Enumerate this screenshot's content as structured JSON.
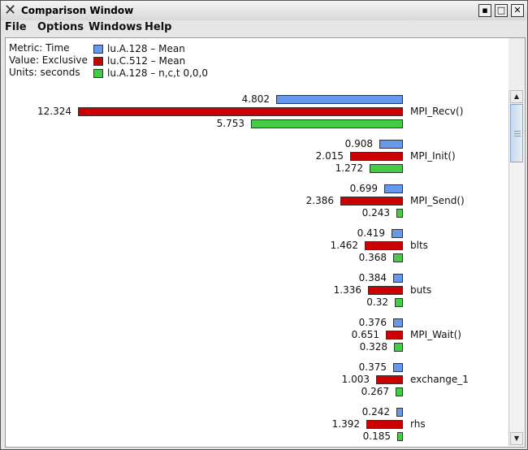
{
  "window": {
    "title": "Comparison Window"
  },
  "menu": [
    "File",
    "Options",
    "Windows",
    "Help"
  ],
  "info": {
    "metric": "Metric: Time",
    "value": "Value: Exclusive",
    "units": "Units: seconds"
  },
  "colors": {
    "series1": "#6699ee",
    "series2": "#cc0000",
    "series3": "#44cc44"
  },
  "legend": [
    "lu.A.128 – Mean",
    "lu.C.512 – Mean",
    "lu.A.128 – n,c,t 0,0,0"
  ],
  "chart_data": {
    "type": "bar",
    "orientation": "horizontal",
    "categories": [
      "MPI_Recv()",
      "MPI_Init()",
      "MPI_Send()",
      "blts",
      "buts",
      "MPI_Wait()",
      "exchange_1",
      "rhs"
    ],
    "series": [
      {
        "name": "lu.A.128 – Mean",
        "values": [
          4.802,
          0.908,
          0.699,
          0.419,
          0.384,
          0.376,
          0.375,
          0.242
        ]
      },
      {
        "name": "lu.C.512 – Mean",
        "values": [
          12.324,
          2.015,
          2.386,
          1.462,
          1.336,
          0.651,
          1.003,
          1.392
        ]
      },
      {
        "name": "lu.A.128 – n,c,t 0,0,0",
        "values": [
          5.753,
          1.272,
          0.243,
          0.368,
          0.32,
          0.328,
          0.267,
          0.185
        ]
      }
    ],
    "value_labels": [
      [
        "4.802",
        "12.324",
        "5.753"
      ],
      [
        "0.908",
        "2.015",
        "1.272"
      ],
      [
        "0.699",
        "2.386",
        "0.243"
      ],
      [
        "0.419",
        "1.462",
        "0.368"
      ],
      [
        "0.384",
        "1.336",
        "0.32"
      ],
      [
        "0.376",
        "0.651",
        "0.328"
      ],
      [
        "0.375",
        "1.003",
        "0.267"
      ],
      [
        "0.242",
        "1.392",
        "0.185"
      ]
    ]
  }
}
